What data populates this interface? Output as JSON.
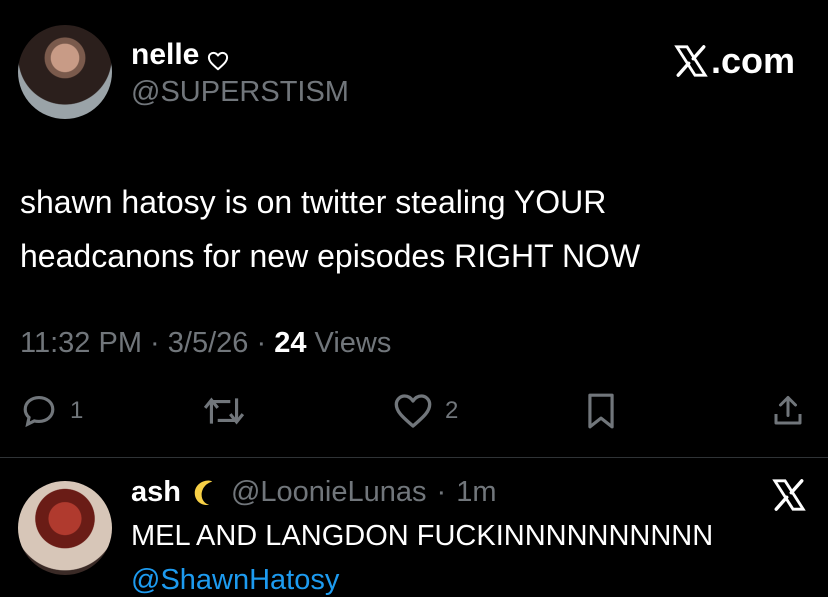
{
  "post": {
    "author": {
      "display_name": "nelle",
      "handle": "@SUPERSTISM"
    },
    "brand": ".com",
    "text_line1": "shawn hatosy is on twitter stealing YOUR",
    "text_line2": "headcanons for new episodes RIGHT NOW",
    "time": "11:32 PM",
    "date": "3/5/26",
    "views_count": "24",
    "views_label": "Views",
    "replies": "1",
    "likes": "2"
  },
  "reply": {
    "display_name": "ash",
    "handle": "@LoonieLunas",
    "time": "1m",
    "text": "MEL AND LANGDON FUCKINNNNNNNNNN",
    "mention": "@ShawnHatosy"
  },
  "colors": {
    "background": "#000000",
    "text": "#ffffff",
    "secondary": "#71767b",
    "link": "#1d9bf0",
    "divider": "#2f3336"
  },
  "icons": {
    "heart": "heart-outline-icon",
    "brand": "x-logo-icon",
    "reply": "speech-bubble-icon",
    "repost": "repost-icon",
    "like": "heart-icon",
    "bookmark": "bookmark-icon",
    "share": "share-icon",
    "moon": "crescent-moon-icon"
  }
}
